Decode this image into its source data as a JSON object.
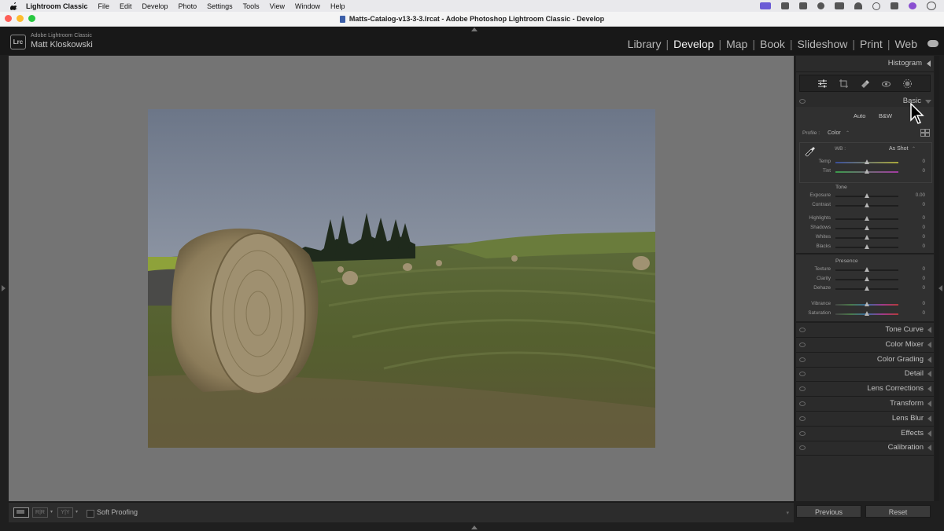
{
  "menubar": {
    "app": "Lightroom Classic",
    "items": [
      "File",
      "Edit",
      "Develop",
      "Photo",
      "Settings",
      "Tools",
      "View",
      "Window",
      "Help"
    ]
  },
  "window": {
    "title": "Matts-Catalog-v13-3-3.lrcat - Adobe Photoshop Lightroom Classic - Develop"
  },
  "identity": {
    "app_name": "Adobe Lightroom Classic",
    "user": "Matt Kloskowski",
    "logo": "Lrc"
  },
  "modules": [
    {
      "label": "Library",
      "active": false
    },
    {
      "label": "Develop",
      "active": true
    },
    {
      "label": "Map",
      "active": false
    },
    {
      "label": "Book",
      "active": false
    },
    {
      "label": "Slideshow",
      "active": false
    },
    {
      "label": "Print",
      "active": false
    },
    {
      "label": "Web",
      "active": false
    }
  ],
  "toolbar": {
    "ry_label": "R|R",
    "yy_label": "Y|Y",
    "soft_proofing": "Soft Proofing",
    "soft_proofing_checked": false
  },
  "panel": {
    "histogram": "Histogram",
    "tools": [
      "edit-sliders-icon",
      "crop-icon",
      "heal-icon",
      "red-eye-icon",
      "masking-icon"
    ],
    "basic": {
      "title": "Basic",
      "auto": "Auto",
      "bw": "B&W",
      "profile_label": "Profile :",
      "profile_value": "Color",
      "wb_label": "WB :",
      "wb_value": "As Shot",
      "tone_label": "Tone",
      "presence_label": "Presence",
      "sliders": [
        {
          "name": "Temp",
          "value": "0",
          "pos": 0.5,
          "group": "wb"
        },
        {
          "name": "Tint",
          "value": "0",
          "pos": 0.5,
          "group": "wb"
        },
        {
          "name": "Exposure",
          "value": "0.00",
          "pos": 0.5,
          "group": "tone"
        },
        {
          "name": "Contrast",
          "value": "0",
          "pos": 0.5,
          "group": "tone"
        },
        {
          "name": "Highlights",
          "value": "0",
          "pos": 0.5,
          "group": "tone"
        },
        {
          "name": "Shadows",
          "value": "0",
          "pos": 0.5,
          "group": "tone"
        },
        {
          "name": "Whites",
          "value": "0",
          "pos": 0.5,
          "group": "tone"
        },
        {
          "name": "Blacks",
          "value": "0",
          "pos": 0.5,
          "group": "tone"
        },
        {
          "name": "Texture",
          "value": "0",
          "pos": 0.5,
          "group": "presence"
        },
        {
          "name": "Clarity",
          "value": "0",
          "pos": 0.5,
          "group": "presence"
        },
        {
          "name": "Dehaze",
          "value": "0",
          "pos": 0.5,
          "group": "presence"
        },
        {
          "name": "Vibrance",
          "value": "0",
          "pos": 0.5,
          "group": "presence"
        },
        {
          "name": "Saturation",
          "value": "0",
          "pos": 0.5,
          "group": "presence"
        }
      ]
    },
    "collapsed": [
      "Tone Curve",
      "Color Mixer",
      "Color Grading",
      "Detail",
      "Lens Corrections",
      "Transform",
      "Lens Blur",
      "Effects",
      "Calibration"
    ],
    "previous": "Previous",
    "reset": "Reset"
  },
  "colors": {
    "canvas": "#747474",
    "panel": "#2b2b2b",
    "accent_purple": "#6b5bd6"
  }
}
